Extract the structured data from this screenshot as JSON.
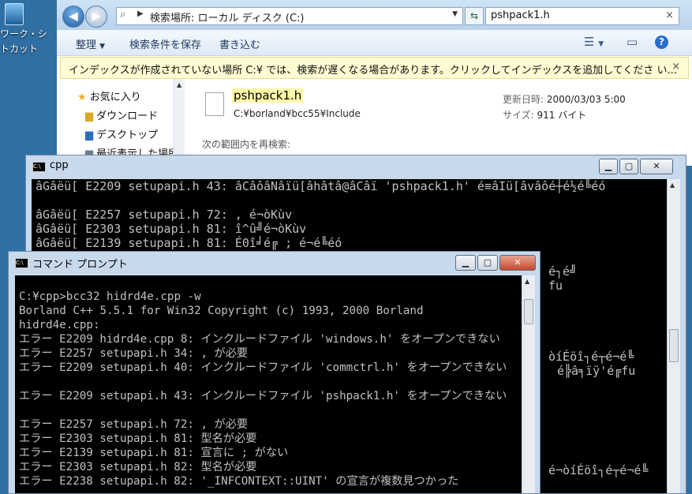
{
  "desktop": {
    "icon_label_line1": "ワーク・シ",
    "icon_label_line2": "トカット"
  },
  "explorer": {
    "address": "検索場所: ローカル ディスク (C:)",
    "search_value": "pshpack1.h",
    "toolbar": {
      "organize": "整理",
      "save_search": "検索条件を保存",
      "burn": "書き込む"
    },
    "infobar": "インデックスが作成されていない場所 C:¥ では、検索が遅くなる場合があります。クリックしてインデックスを追加してくださ い...",
    "nav": {
      "favorites": "お気に入り",
      "items": [
        "ダウンロード",
        "デスクトップ",
        "最近表示した場所"
      ]
    },
    "result": {
      "filename": "pshpack1.h",
      "path": "C:¥borland¥bcc55¥Include",
      "modified_label": "更新日時:",
      "modified_value": "2000/03/03 5:00",
      "size_label": "サイズ:",
      "size_value": "911 バイト",
      "research_label": "次の範囲内を再検索:"
    }
  },
  "cpp_window": {
    "title": "cpp",
    "lines": [
      "âGâëü[ E2209 setupapi.h 43: âCâôâNâïü[âhâtâ@âCâï 'pshpack1.h' é≡âIü[âvâôé┼é½é╚éó",
      "",
      "âGâëü[ E2257 setupapi.h 72: , é¬òKùv",
      "âGâëü[ E2303 setupapi.h 81: î^û╝é¬òKùv",
      "âGâëü[ E2139 setupapi.h 81: É0î╛é╔ ; é¬é╚éó"
    ],
    "right_fragments": [
      "é┐é╝",
      "fu",
      "òíÉöî┐é┬é¬é╚",
      "é╠â╕ïÿ'é╔fu",
      "é¬òíÉöî┐é┬é¬é╚"
    ]
  },
  "cmd_window": {
    "title": "コマンド プロンプト",
    "lines": [
      "",
      "C:¥cpp>bcc32 hidrd4e.cpp -w",
      "Borland C++ 5.5.1 for Win32 Copyright (c) 1993, 2000 Borland",
      "hidrd4e.cpp:",
      "エラー E2209 hidrd4e.cpp 8: インクルードファイル 'windows.h' をオープンできない",
      "エラー E2257 setupapi.h 34: , が必要",
      "エラー E2209 setupapi.h 40: インクルードファイル 'commctrl.h' をオープンできない",
      "",
      "エラー E2209 setupapi.h 43: インクルードファイル 'pshpack1.h' をオープンできない",
      "",
      "エラー E2257 setupapi.h 72: , が必要",
      "エラー E2303 setupapi.h 81: 型名が必要",
      "エラー E2139 setupapi.h 81: 宣言に ; がない",
      "エラー E2303 setupapi.h 82: 型名が必要",
      "エラー E2238 setupapi.h 82: '_INFCONTEXT::UINT' の宣言が複数見つかった"
    ]
  }
}
